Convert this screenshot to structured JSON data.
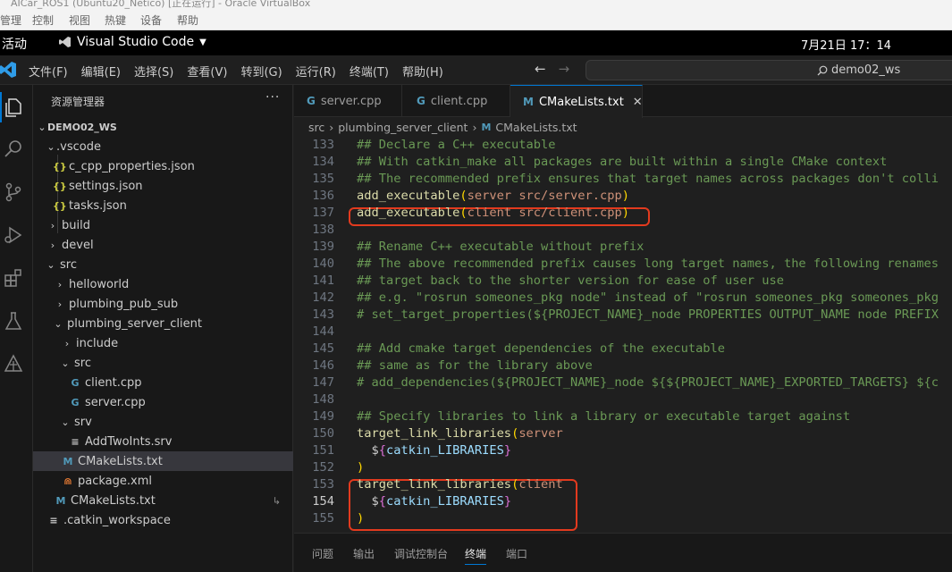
{
  "vbox": {
    "title": "AICar_ROS1 (Ubuntu20_Netico) [正在运行] - Oracle VirtualBox",
    "menu": [
      "管理",
      "控制",
      "视图",
      "热键",
      "设备",
      "帮助"
    ]
  },
  "gnome": {
    "activities": "活动",
    "app_name": "Visual Studio Code",
    "clock": "7月21日  17：14"
  },
  "vscode": {
    "menu": [
      "文件(F)",
      "编辑(E)",
      "选择(S)",
      "查看(V)",
      "转到(G)",
      "运行(R)",
      "终端(T)",
      "帮助(H)"
    ],
    "search_text": "demo02_ws"
  },
  "sidebar": {
    "title": "资源管理器",
    "more": "···",
    "tree": [
      {
        "label": "DEMO02_WS",
        "kind": "workspace"
      },
      {
        "label": ".vscode",
        "kind": "folder-open"
      },
      {
        "label": "c_cpp_properties.json",
        "kind": "json"
      },
      {
        "label": "settings.json",
        "kind": "json"
      },
      {
        "label": "tasks.json",
        "kind": "json"
      },
      {
        "label": "build",
        "kind": "folder"
      },
      {
        "label": "devel",
        "kind": "folder"
      },
      {
        "label": "src",
        "kind": "folder-open"
      },
      {
        "label": "helloworld",
        "kind": "folder"
      },
      {
        "label": "plumbing_pub_sub",
        "kind": "folder"
      },
      {
        "label": "plumbing_server_client",
        "kind": "folder-open"
      },
      {
        "label": "include",
        "kind": "folder"
      },
      {
        "label": "src",
        "kind": "folder-open"
      },
      {
        "label": "client.cpp",
        "kind": "cpp"
      },
      {
        "label": "server.cpp",
        "kind": "cpp"
      },
      {
        "label": "srv",
        "kind": "folder-open"
      },
      {
        "label": "AddTwoInts.srv",
        "kind": "lines"
      },
      {
        "label": "CMakeLists.txt",
        "kind": "cmake"
      },
      {
        "label": "package.xml",
        "kind": "xml"
      },
      {
        "label": "CMakeLists.txt",
        "kind": "cmake"
      },
      {
        "label": ".catkin_workspace",
        "kind": "lines"
      }
    ]
  },
  "tabs": [
    {
      "label": "server.cpp",
      "icon": "G"
    },
    {
      "label": "client.cpp",
      "icon": "G"
    },
    {
      "label": "CMakeLists.txt",
      "icon": "M",
      "close": "✕"
    }
  ],
  "breadcrumb": [
    "src",
    "plumbing_server_client",
    "CMakeLists.txt"
  ],
  "editor": {
    "lines": [
      {
        "n": "133",
        "t": "## Declare a C++ executable"
      },
      {
        "n": "134",
        "t": "## With catkin_make all packages are built within a single CMake context"
      },
      {
        "n": "135",
        "t": "## The recommended prefix ensures that target names across packages don't colli"
      },
      {
        "n": "136",
        "t": "add_executable(server src/server.cpp)"
      },
      {
        "n": "137",
        "t": "add_executable(client src/client.cpp)"
      },
      {
        "n": "138",
        "t": ""
      },
      {
        "n": "139",
        "t": "## Rename C++ executable without prefix"
      },
      {
        "n": "140",
        "t": "## The above recommended prefix causes long target names, the following renames"
      },
      {
        "n": "141",
        "t": "## target back to the shorter version for ease of user use"
      },
      {
        "n": "142",
        "t": "## e.g. \"rosrun someones_pkg node\" instead of \"rosrun someones_pkg someones_pkg"
      },
      {
        "n": "143",
        "t": "# set_target_properties(${PROJECT_NAME}_node PROPERTIES OUTPUT_NAME node PREFIX"
      },
      {
        "n": "144",
        "t": ""
      },
      {
        "n": "145",
        "t": "## Add cmake target dependencies of the executable"
      },
      {
        "n": "146",
        "t": "## same as for the library above"
      },
      {
        "n": "147",
        "t": "# add_dependencies(${PROJECT_NAME}_node ${${PROJECT_NAME}_EXPORTED_TARGETS} ${c"
      },
      {
        "n": "148",
        "t": ""
      },
      {
        "n": "149",
        "t": "## Specify libraries to link a library or executable target against"
      },
      {
        "n": "150",
        "t": "target_link_libraries(server"
      },
      {
        "n": "151",
        "t": "  ${catkin_LIBRARIES}"
      },
      {
        "n": "152",
        "t": ")"
      },
      {
        "n": "153",
        "t": "target_link_libraries(client"
      },
      {
        "n": "154",
        "t": "  ${catkin_LIBRARIES}"
      },
      {
        "n": "155",
        "t": ")"
      }
    ],
    "current_line": "154"
  },
  "panel_tabs": [
    "问题",
    "输出",
    "调试控制台",
    "终端",
    "端口"
  ],
  "colors": {
    "accent": "#0078d4",
    "highlight_box": "#e23a1e",
    "comment": "#6a9955",
    "function": "#dcdcaa",
    "string_arg": "#ce9178"
  }
}
